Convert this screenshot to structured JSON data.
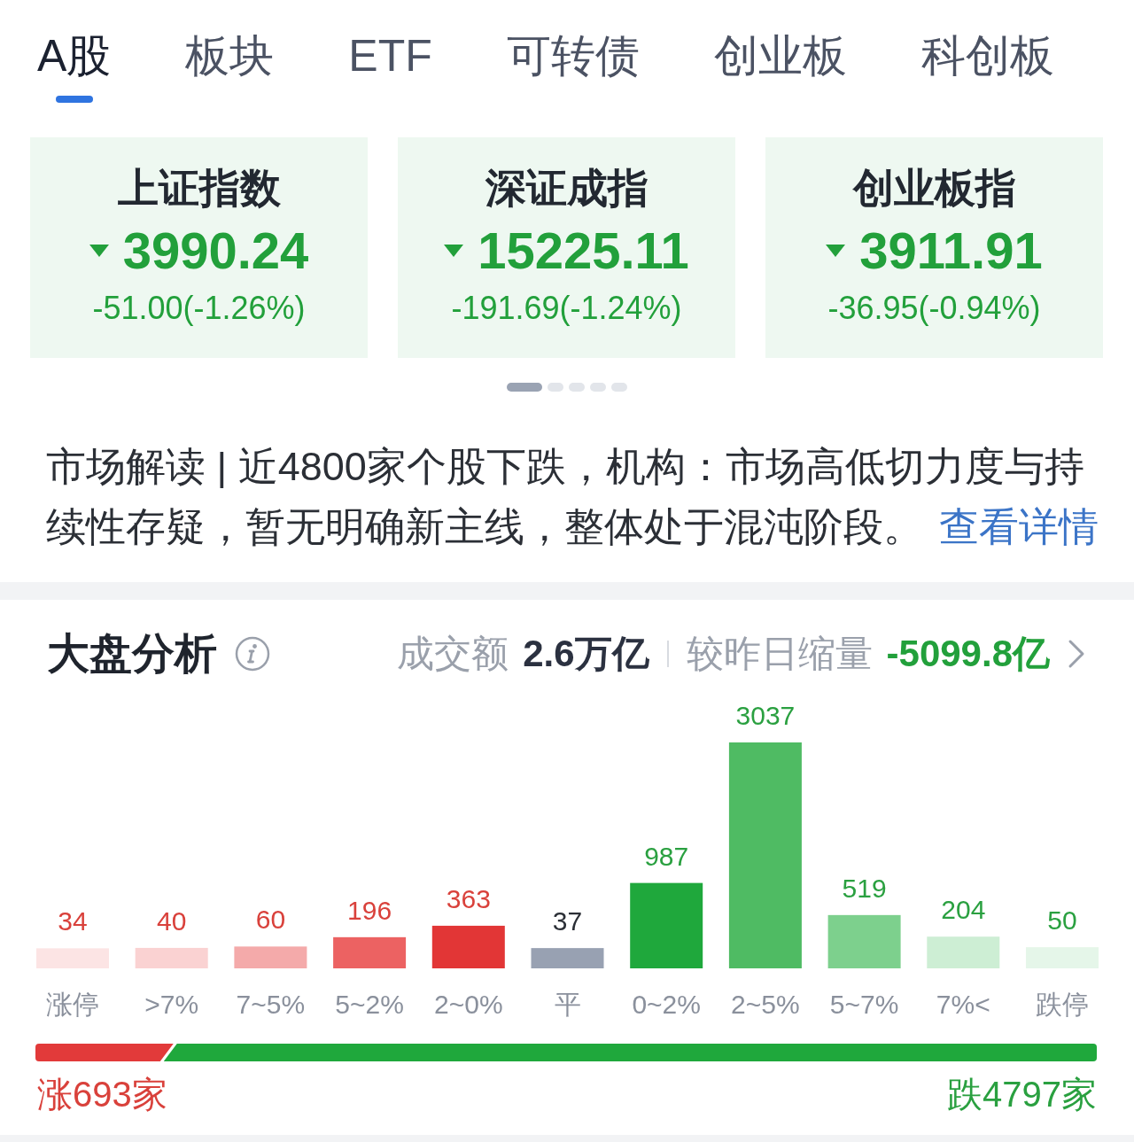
{
  "tabs": [
    {
      "label": "A股",
      "selected": true
    },
    {
      "label": "板块",
      "selected": false
    },
    {
      "label": "ETF",
      "selected": false
    },
    {
      "label": "可转债",
      "selected": false
    },
    {
      "label": "创业板",
      "selected": false
    },
    {
      "label": "科创板",
      "selected": false
    }
  ],
  "index_cards": [
    {
      "name": "上证指数",
      "falling": true,
      "value": "3990.24",
      "change": "-51.00(-1.26%)"
    },
    {
      "name": "深证成指",
      "falling": true,
      "value": "15225.11",
      "change": "-191.69(-1.24%)"
    },
    {
      "name": "创业板指",
      "falling": true,
      "value": "3911.91",
      "change": "-36.95(-0.94%)"
    }
  ],
  "pager": [
    {
      "selected": true
    },
    {
      "selected": false
    },
    {
      "selected": false
    },
    {
      "selected": false
    },
    {
      "selected": false
    }
  ],
  "market_note": {
    "text": "市场解读 | 近4800家个股下跌，机构：市场高低切力度与持续性存疑，暂无明确新主线，整体处于混沌阶段。",
    "link": "查看详情"
  },
  "analysis": {
    "title": "大盘分析",
    "turnover_label": "成交额",
    "turnover": "2.6万亿",
    "compare_label": "较昨日缩量",
    "compare_value": "-5099.8亿",
    "chart": {
      "chart_data": {
        "type": "bar",
        "categories": [
          "涨停",
          ">7%",
          "7~5%",
          "5~2%",
          "2~0%",
          "平",
          "0~2%",
          "2~5%",
          "5~7%",
          "7%<",
          "跌停"
        ],
        "values": [
          34,
          40,
          60,
          196,
          363,
          37,
          987,
          3037,
          519,
          204,
          50
        ],
        "data_labels": true
      },
      "bars": [
        {
          "color": "#fce4e4",
          "kind": "up"
        },
        {
          "color": "#fad2d2",
          "kind": "up"
        },
        {
          "color": "#f4aaaa",
          "kind": "up"
        },
        {
          "color": "#ec6262",
          "kind": "up"
        },
        {
          "color": "#e23636",
          "kind": "up"
        },
        {
          "color": "#98a1b2",
          "kind": "flat"
        },
        {
          "color": "#1fa83c",
          "kind": "down"
        },
        {
          "color": "#4fbb63",
          "kind": "down"
        },
        {
          "color": "#7dd08d",
          "kind": "down"
        },
        {
          "color": "#cdeed4",
          "kind": "down"
        },
        {
          "color": "#e5f6e9",
          "kind": "down"
        }
      ]
    },
    "breadth": {
      "level": 0.13,
      "up_label": "涨693家",
      "down_label": "跌4797家"
    }
  }
}
